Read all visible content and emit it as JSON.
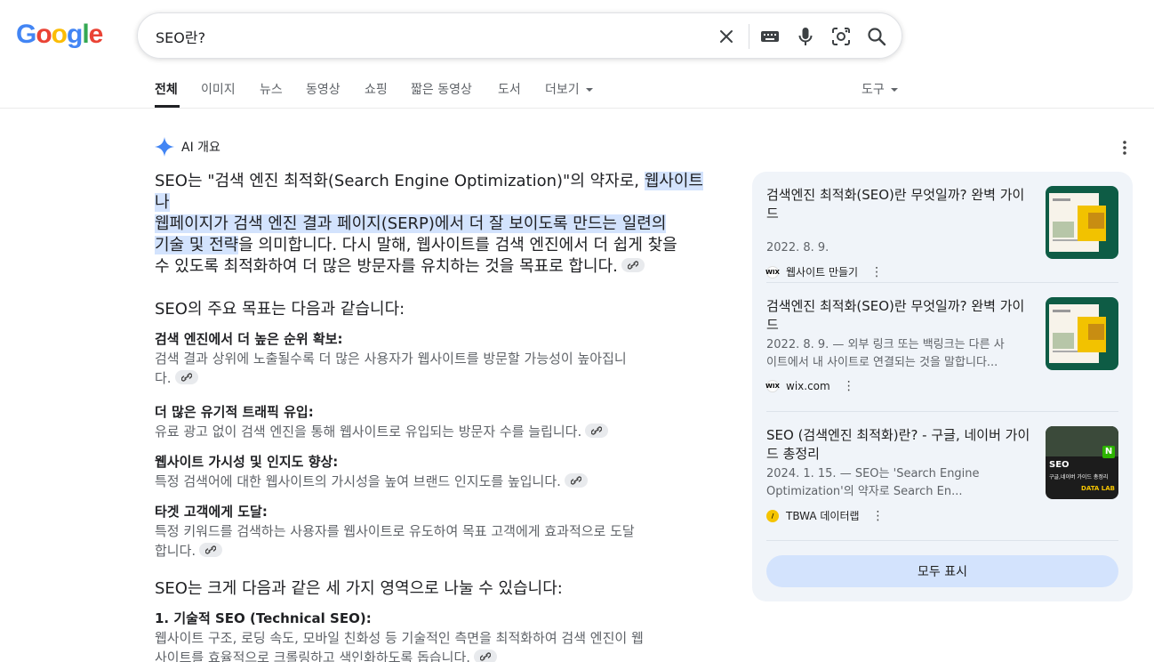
{
  "logo": {
    "letters": [
      "G",
      "o",
      "o",
      "g",
      "l",
      "e"
    ]
  },
  "search": {
    "query": "SEO란?"
  },
  "tabs": [
    "전체",
    "이미지",
    "뉴스",
    "동영상",
    "쇼핑",
    "짧은 동영상",
    "도서",
    "더보기"
  ],
  "tools_label": "도구",
  "ai": {
    "header_label": "AI 개요",
    "intro_a": "SEO는 \"검색 엔진 최적화(Search Engine Optimization)\"의 약자로, ",
    "intro_hl_1": "웹사이트나",
    "intro_hl_2": "웹페이지가 검색 엔진 결과 페이지(SERP)에서 더 잘 보이도록 만드는 일련의",
    "intro_hl_3": "기술 및 전략",
    "intro_b": "을 의미합니다. 다시 말해, 웹사이트를 검색 엔진에서 더 쉽게 찾을",
    "intro_c": "수 있도록 최적화하여 더 많은 방문자를 유치하는 것을 목표로 합니다.",
    "goals_heading": "SEO의 주요 목표는 다음과 같습니다:",
    "goals": [
      {
        "title": "검색 엔진에서 더 높은 순위 확보:",
        "body_1": "검색 결과 상위에 노출될수록 더 많은 사용자가 웹사이트를 방문할 가능성이 높아집니",
        "body_2": "다."
      },
      {
        "title": "더 많은 유기적 트래픽 유입:",
        "body_1": "유료 광고 없이 검색 엔진을 통해 웹사이트로 유입되는 방문자 수를 늘립니다.",
        "body_2": ""
      },
      {
        "title": "웹사이트 가시성 및 인지도 향상:",
        "body_1": "특정 검색어에 대한 웹사이트의 가시성을 높여 브랜드 인지도를 높입니다.",
        "body_2": ""
      },
      {
        "title": "타겟 고객에게 도달:",
        "body_1": "특정 키워드를 검색하는 사용자를 웹사이트로 유도하여 목표 고객에게 효과적으로 도달",
        "body_2": "합니다."
      }
    ],
    "areas_heading": "SEO는 크게 다음과 같은 세 가지 영역으로 나눌 수 있습니다:",
    "areas": [
      {
        "title": "1. 기술적 SEO (Technical SEO):",
        "body_1": "웹사이트 구조, 로딩 속도, 모바일 친화성 등 기술적인 측면을 최적화하여 검색 엔진이 웹",
        "body_2": "사이트를 효율적으로 크롤링하고 색인화하도록 돕습니다."
      }
    ]
  },
  "sources": [
    {
      "title": "검색엔진 최적화(SEO)란 무엇일까? 완벽 가이드",
      "meta_1": "2022. 8. 9.",
      "meta_2": "",
      "site": "웹사이트 만들기",
      "favicon_text": "WIX"
    },
    {
      "title": "검색엔진 최적화(SEO)란 무엇일까? 완벽 가이드",
      "meta_1": "2022. 8. 9. — 외부 링크 또는 백링크는 다른 사",
      "meta_2": "이트에서 내 사이트로 연결되는 것을 말합니다...",
      "site": "wix.com",
      "favicon_text": "WIX"
    },
    {
      "title": "SEO (검색엔진 최적화)란? - 구글, 네이버 가이드 총정리",
      "meta_1": "2024. 1. 15. — SEO는 'Search Engine",
      "meta_2": "Optimization'의 약자로 Search En...",
      "site": "TBWA 데이터랩",
      "favicon_text": "/",
      "thumb_text_1": "SEO",
      "thumb_text_2": "구글,네이버 가이드 총정리",
      "thumb_text_3": "DATA LAB"
    }
  ],
  "show_all_label": "모두 표시",
  "colors": {
    "google_blue": "#4285F4",
    "google_red": "#EA4335",
    "google_yellow": "#FBBC05",
    "google_green": "#34A853",
    "highlight": "#d3e3fd",
    "panel_bg": "#f0f4f9"
  }
}
